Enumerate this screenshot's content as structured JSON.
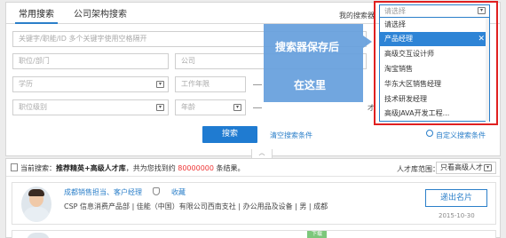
{
  "tabs": [
    "常用搜索",
    "公司架构搜索"
  ],
  "saved_search": {
    "label": "我的搜索器",
    "placeholder": "请选择",
    "options": [
      "请选择",
      "产品经理",
      "高级交互设计师",
      "淘宝销售",
      "华东大区销售经理",
      "技术研发经理",
      "高级JAVA开发工程..."
    ],
    "selected_index": 1
  },
  "form": {
    "keyword_placeholder": "关键字/职能/ID  多个关键字使用空格隔开",
    "position_placeholder": "职位/部门",
    "company_placeholder": "公司",
    "education_placeholder": "学历",
    "work_years_placeholder": "工作年限",
    "job_level_placeholder": "职位级别",
    "age_placeholder": "年龄",
    "partial_suffix": "才"
  },
  "actions": {
    "search": "搜索",
    "clear": "清空搜索条件",
    "custom": "自定义搜索条件",
    "collapse": "︿"
  },
  "overlay": {
    "line1": "搜索器保存后",
    "line2": "在这里"
  },
  "results": {
    "prefix": "当前搜索：",
    "query": "推荐精英+高级人才库",
    "middle": "，共为您找到约",
    "count": "80000000",
    "suffix": "条结果。",
    "scope_label": "人才库范围：",
    "scope_value": "只看高级人才"
  },
  "card": {
    "title": "成都销售担当、客户经理",
    "favorite": "收藏",
    "detail": "CSP 信息消费产品部  |  佳能（中国）有限公司西南支社  |  办公用品及设备  |  男  |  成都",
    "button": "递出名片",
    "date": "2015-10-30"
  },
  "card2": {
    "tag": "下载"
  }
}
